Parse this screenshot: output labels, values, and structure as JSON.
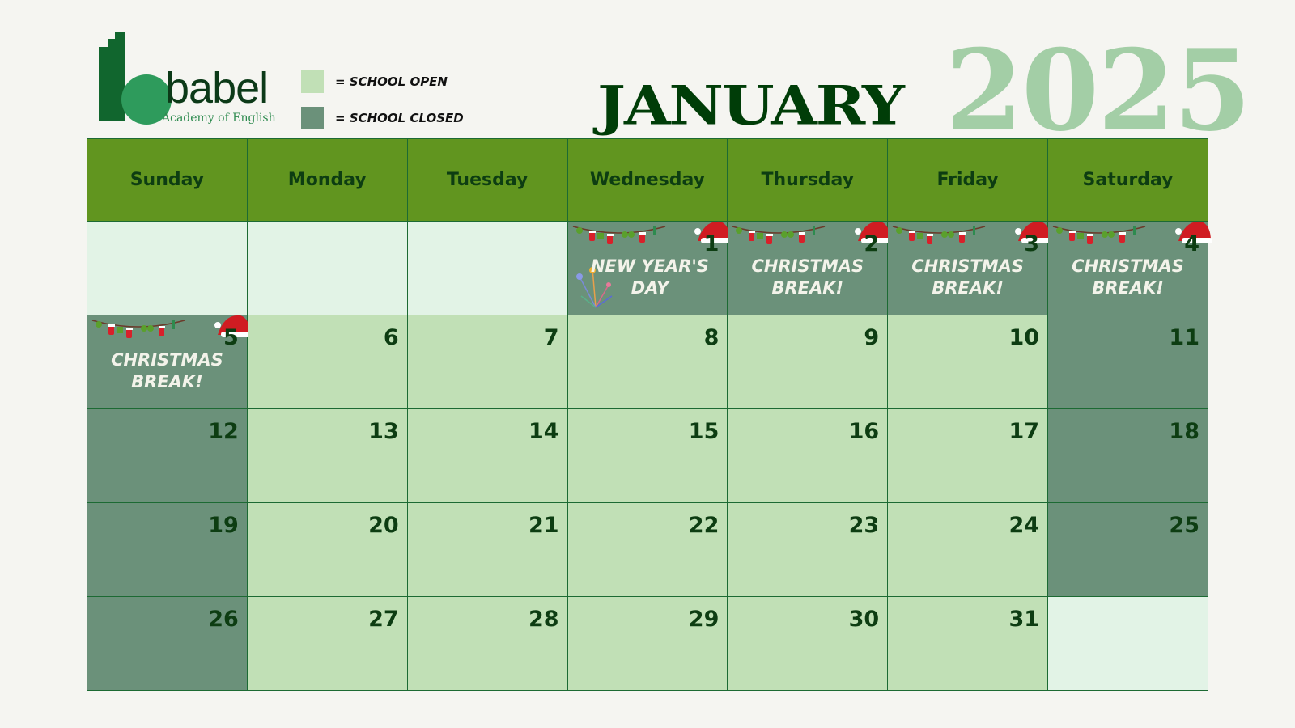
{
  "brand": {
    "name": "babel",
    "tagline": "Academy of English"
  },
  "legend": [
    {
      "label": "= SCHOOL OPEN",
      "color": "#c1e0b6"
    },
    {
      "label": "= SCHOOL CLOSED",
      "color": "#6b917a"
    }
  ],
  "header": {
    "month": "JANUARY",
    "year": "2025"
  },
  "colors": {
    "header_bg": "#61951f",
    "open": "#c1e0b6",
    "closed": "#6b917a",
    "empty": "#e2f3e6",
    "title": "#003d08",
    "year": "#a3cea6"
  },
  "weekdays": [
    "Sunday",
    "Monday",
    "Tuesday",
    "Wednesday",
    "Thursday",
    "Friday",
    "Saturday"
  ],
  "weeks": [
    [
      {
        "day": "",
        "status": "empty"
      },
      {
        "day": "",
        "status": "empty"
      },
      {
        "day": "",
        "status": "empty"
      },
      {
        "day": "1",
        "status": "closed",
        "event": "NEW YEAR'S\nDAY",
        "decor": [
          "garland-icon",
          "santa-hat-icon",
          "firework-icon"
        ]
      },
      {
        "day": "2",
        "status": "closed",
        "event": "CHRISTMAS\nBREAK!",
        "decor": [
          "garland-icon",
          "santa-hat-icon"
        ]
      },
      {
        "day": "3",
        "status": "closed",
        "event": "CHRISTMAS\nBREAK!",
        "decor": [
          "garland-icon",
          "santa-hat-icon"
        ]
      },
      {
        "day": "4",
        "status": "closed",
        "event": "CHRISTMAS\nBREAK!",
        "decor": [
          "garland-icon",
          "santa-hat-icon"
        ]
      }
    ],
    [
      {
        "day": "5",
        "status": "closed",
        "event": "CHRISTMAS\nBREAK!",
        "decor": [
          "garland-icon",
          "santa-hat-icon"
        ]
      },
      {
        "day": "6",
        "status": "open"
      },
      {
        "day": "7",
        "status": "open"
      },
      {
        "day": "8",
        "status": "open"
      },
      {
        "day": "9",
        "status": "open"
      },
      {
        "day": "10",
        "status": "open"
      },
      {
        "day": "11",
        "status": "closed"
      }
    ],
    [
      {
        "day": "12",
        "status": "closed"
      },
      {
        "day": "13",
        "status": "open"
      },
      {
        "day": "14",
        "status": "open"
      },
      {
        "day": "15",
        "status": "open"
      },
      {
        "day": "16",
        "status": "open"
      },
      {
        "day": "17",
        "status": "open"
      },
      {
        "day": "18",
        "status": "closed"
      }
    ],
    [
      {
        "day": "19",
        "status": "closed"
      },
      {
        "day": "20",
        "status": "open"
      },
      {
        "day": "21",
        "status": "open"
      },
      {
        "day": "22",
        "status": "open"
      },
      {
        "day": "23",
        "status": "open"
      },
      {
        "day": "24",
        "status": "open"
      },
      {
        "day": "25",
        "status": "closed"
      }
    ],
    [
      {
        "day": "26",
        "status": "closed"
      },
      {
        "day": "27",
        "status": "open"
      },
      {
        "day": "28",
        "status": "open"
      },
      {
        "day": "29",
        "status": "open"
      },
      {
        "day": "30",
        "status": "open"
      },
      {
        "day": "31",
        "status": "open"
      },
      {
        "day": "",
        "status": "empty"
      }
    ]
  ]
}
